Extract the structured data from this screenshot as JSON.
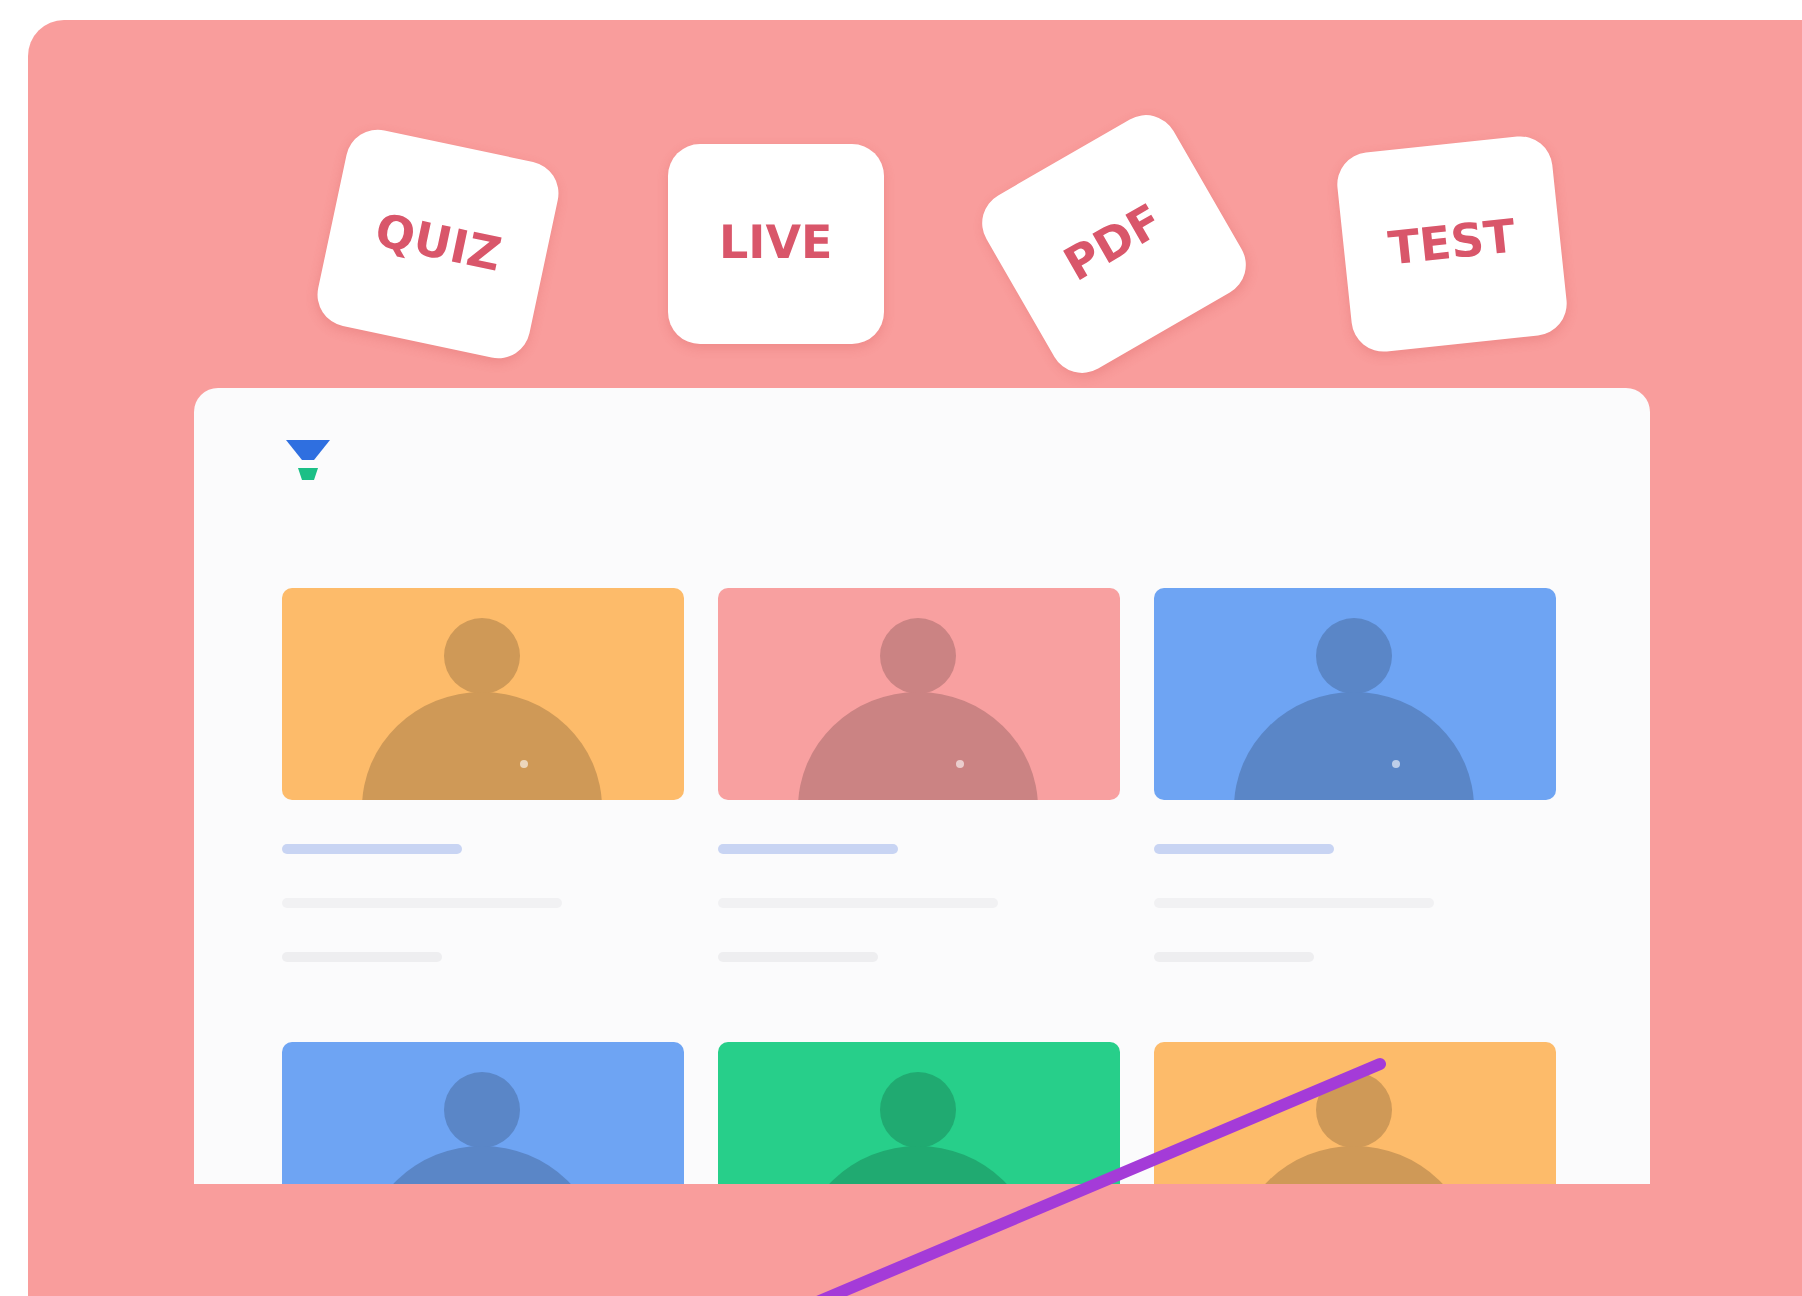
{
  "tags": [
    {
      "label": "QUIZ"
    },
    {
      "label": "LIVE"
    },
    {
      "label": "PDF"
    },
    {
      "label": "TEST"
    }
  ]
}
